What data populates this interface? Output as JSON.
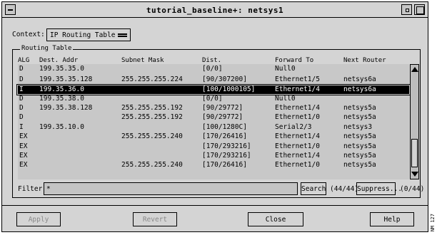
{
  "window": {
    "title": "tutorial_baseline+: netsys1"
  },
  "context": {
    "label": "Context:",
    "value": "IP Routing Table"
  },
  "routing_table": {
    "group_label": "Routing Table",
    "columns": [
      "ALG",
      "Dest. Addr",
      "Subnet Mask",
      "Dist.",
      "Forward To",
      "Next Router"
    ],
    "rows": [
      {
        "alg": "D",
        "dest": "199.35.35.0",
        "mask": "",
        "dist": "[0/0]",
        "forward": "Null0",
        "next": "",
        "selected": false
      },
      {
        "alg": "D",
        "dest": "199.35.35.128",
        "mask": "255.255.255.224",
        "dist": "[90/307200]",
        "forward": "Ethernet1/5",
        "next": "netsys6a",
        "selected": false
      },
      {
        "alg": "I",
        "dest": "199.35.36.0",
        "mask": "",
        "dist": "[100/1000105]",
        "forward": "Ethernet1/4",
        "next": "netsys6a",
        "selected": true
      },
      {
        "alg": "D",
        "dest": "199.35.38.0",
        "mask": "",
        "dist": "[0/0]",
        "forward": "Null0",
        "next": "",
        "selected": false
      },
      {
        "alg": "D",
        "dest": "199.35.38.128",
        "mask": "255.255.255.192",
        "dist": "[90/29772]",
        "forward": "Ethernet1/4",
        "next": "netsys5a",
        "selected": false
      },
      {
        "alg": "D",
        "dest": "",
        "mask": "255.255.255.192",
        "dist": "[90/29772]",
        "forward": "Ethernet1/0",
        "next": "netsys5a",
        "selected": false
      },
      {
        "alg": "I",
        "dest": "199.35.10.0",
        "mask": "",
        "dist": "[100/1280C]",
        "forward": "Serial2/3",
        "next": "netsys3",
        "selected": false
      },
      {
        "alg": "EX",
        "dest": "",
        "mask": "255.255.255.240",
        "dist": "[170/26416]",
        "forward": "Ethernet1/4",
        "next": "netsys5a",
        "selected": false
      },
      {
        "alg": "EX",
        "dest": "",
        "mask": "",
        "dist": "[170/293216]",
        "forward": "Ethernet1/0",
        "next": "netsys5a",
        "selected": false
      },
      {
        "alg": "EX",
        "dest": "",
        "mask": "",
        "dist": "[170/293216]",
        "forward": "Ethernet1/4",
        "next": "netsys5a",
        "selected": false
      },
      {
        "alg": "EX",
        "dest": "",
        "mask": "255.255.255.240",
        "dist": "[170/26416]",
        "forward": "Ethernet1/0",
        "next": "netsys5a",
        "selected": false
      }
    ]
  },
  "filter": {
    "label": "Filter:",
    "value": "*",
    "search_label": "Search",
    "count_a": "(44/44)",
    "suppress_label": "Suppress...",
    "count_b": "(0/44)"
  },
  "buttons": {
    "apply": "Apply",
    "revert": "Revert",
    "close": "Close",
    "help": "Help"
  },
  "side_code": "NM 127"
}
